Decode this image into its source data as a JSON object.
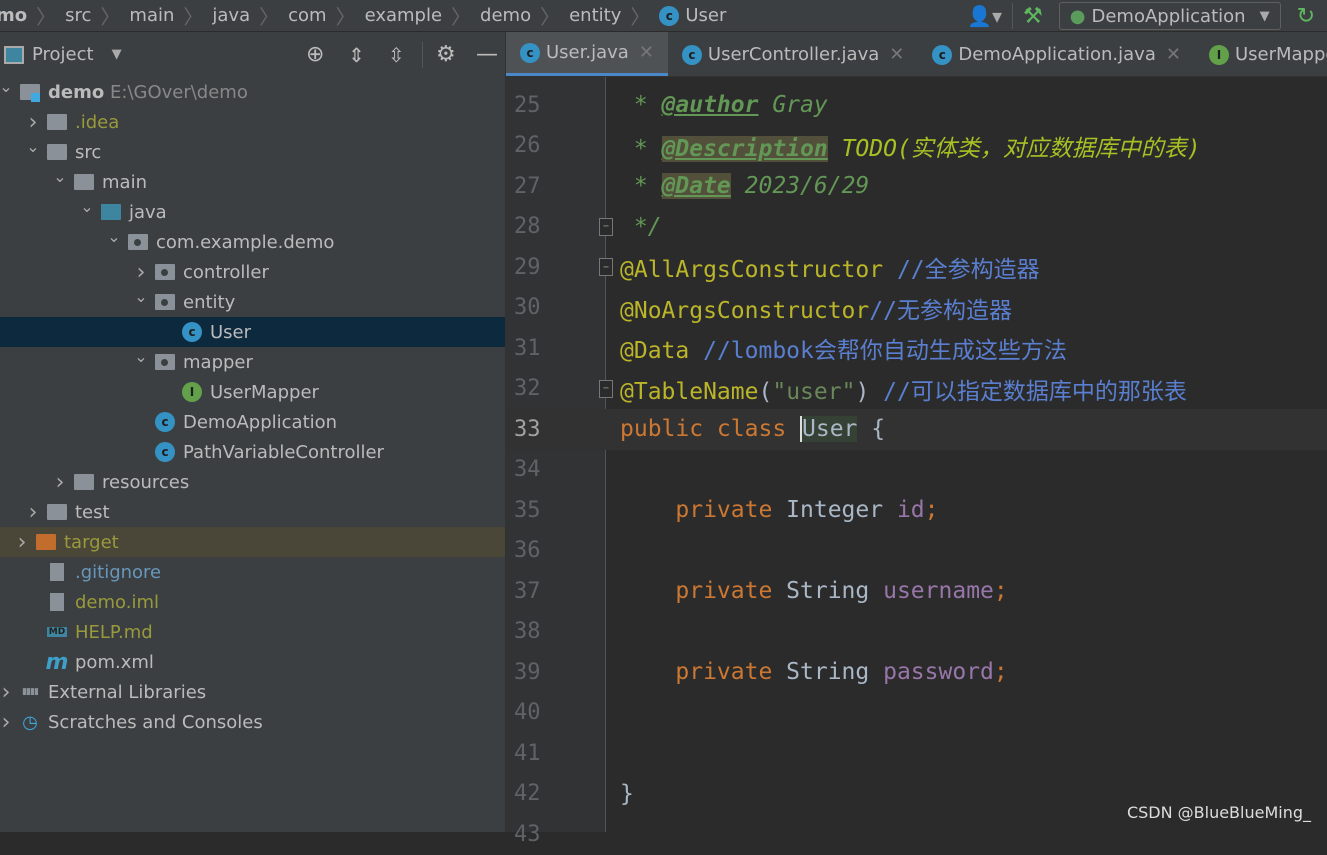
{
  "breadcrumb": [
    "mo",
    "src",
    "main",
    "java",
    "com",
    "example",
    "demo",
    "entity",
    "User"
  ],
  "toolbar": {
    "run_config": "DemoApplication",
    "icons": [
      "user-icon",
      "hammer-icon",
      "rerun-icon"
    ]
  },
  "project_panel": {
    "title": "Project"
  },
  "tree": [
    {
      "depth": 0,
      "label": "demo",
      "sub": "E:\\GOver\\demo",
      "arrow": "v",
      "icon": "module",
      "bold": true
    },
    {
      "depth": 1,
      "label": ".idea",
      "arrow": ">",
      "icon": "folder",
      "color": "#999a3b"
    },
    {
      "depth": 1,
      "label": "src",
      "arrow": "v",
      "icon": "folder"
    },
    {
      "depth": 2,
      "label": "main",
      "arrow": "v",
      "icon": "folder"
    },
    {
      "depth": 3,
      "label": "java",
      "arrow": "v",
      "icon": "folder-blue"
    },
    {
      "depth": 4,
      "label": "com.example.demo",
      "arrow": "v",
      "icon": "package"
    },
    {
      "depth": 5,
      "label": "controller",
      "arrow": ">",
      "icon": "package"
    },
    {
      "depth": 5,
      "label": "entity",
      "arrow": "v",
      "icon": "package"
    },
    {
      "depth": 6,
      "label": "User",
      "arrow": "",
      "icon": "class",
      "selected": true
    },
    {
      "depth": 5,
      "label": "mapper",
      "arrow": "v",
      "icon": "package"
    },
    {
      "depth": 6,
      "label": "UserMapper",
      "arrow": "",
      "icon": "interface"
    },
    {
      "depth": 5,
      "label": "DemoApplication",
      "arrow": "",
      "icon": "spring-class"
    },
    {
      "depth": 5,
      "label": "PathVariableController",
      "arrow": "",
      "icon": "class"
    },
    {
      "depth": 2,
      "label": "resources",
      "arrow": ">",
      "icon": "folder"
    },
    {
      "depth": 1,
      "label": "test",
      "arrow": ">",
      "icon": "folder"
    },
    {
      "depth": 0.6,
      "label": "target",
      "arrow": ">",
      "icon": "folder-orange",
      "color": "#999a3b",
      "ignored": true
    },
    {
      "depth": 1,
      "label": ".gitignore",
      "arrow": "",
      "icon": "file",
      "color": "#6897bb"
    },
    {
      "depth": 1,
      "label": "demo.iml",
      "arrow": "",
      "icon": "file",
      "color": "#999a3b"
    },
    {
      "depth": 1,
      "label": "HELP.md",
      "arrow": "",
      "icon": "md",
      "color": "#999a3b"
    },
    {
      "depth": 1,
      "label": "pom.xml",
      "arrow": "",
      "icon": "maven"
    },
    {
      "depth": 0,
      "label": "External Libraries",
      "arrow": ">",
      "icon": "libs"
    },
    {
      "depth": 0,
      "label": "Scratches and Consoles",
      "arrow": ">",
      "icon": "scratch"
    }
  ],
  "tabs": [
    {
      "label": "User.java",
      "icon": "class",
      "active": true
    },
    {
      "label": "UserController.java",
      "icon": "class"
    },
    {
      "label": "DemoApplication.java",
      "icon": "spring-class"
    },
    {
      "label": "UserMapper.java",
      "icon": "interface"
    }
  ],
  "editor": {
    "current_line": 33,
    "lines": [
      {
        "n": 25,
        "tokens": [
          [
            " * ",
            "doc"
          ],
          [
            "@author",
            "tag"
          ],
          [
            " Gray",
            "doc"
          ]
        ]
      },
      {
        "n": 26,
        "tokens": [
          [
            " * ",
            "doc"
          ],
          [
            "@Description",
            "tag hl"
          ],
          [
            " TODO(实体类，对应数据库中的表)",
            "todo"
          ]
        ]
      },
      {
        "n": 27,
        "tokens": [
          [
            " * ",
            "doc"
          ],
          [
            "@Date",
            "tag hl"
          ],
          [
            " 2023/6/29",
            "doc"
          ]
        ]
      },
      {
        "n": 28,
        "fold": true,
        "tokens": [
          [
            " */",
            "doc"
          ]
        ]
      },
      {
        "n": 29,
        "fold": true,
        "tokens": [
          [
            "@AllArgsConstructor",
            "ann"
          ],
          [
            " //全参构造器",
            "cm"
          ]
        ]
      },
      {
        "n": 30,
        "tokens": [
          [
            "@NoArgsConstructor",
            "ann"
          ],
          [
            "//无参构造器",
            "cm"
          ]
        ]
      },
      {
        "n": 31,
        "tokens": [
          [
            "@Data",
            "ann"
          ],
          [
            " //lombok会帮你自动生成这些方法",
            "cm"
          ]
        ]
      },
      {
        "n": 32,
        "fold": true,
        "tokens": [
          [
            "@TableName",
            "ann"
          ],
          [
            "(",
            "id"
          ],
          [
            "\"user\"",
            "str"
          ],
          [
            ")",
            "id"
          ],
          [
            " //可以指定数据库中的那张表",
            "cm"
          ]
        ]
      },
      {
        "n": 33,
        "tokens": [
          [
            "public class ",
            "kw"
          ],
          [
            "User",
            "cls"
          ],
          [
            " {",
            "id"
          ]
        ]
      },
      {
        "n": 34,
        "tokens": []
      },
      {
        "n": 35,
        "tokens": [
          [
            "    private ",
            "kw"
          ],
          [
            "Integer ",
            "id"
          ],
          [
            "id",
            "fld"
          ],
          [
            ";",
            "kw"
          ]
        ]
      },
      {
        "n": 36,
        "tokens": []
      },
      {
        "n": 37,
        "tokens": [
          [
            "    private ",
            "kw"
          ],
          [
            "String ",
            "id"
          ],
          [
            "username",
            "fld"
          ],
          [
            ";",
            "kw"
          ]
        ]
      },
      {
        "n": 38,
        "tokens": []
      },
      {
        "n": 39,
        "tokens": [
          [
            "    private ",
            "kw"
          ],
          [
            "String ",
            "id"
          ],
          [
            "password",
            "fld"
          ],
          [
            ";",
            "kw"
          ]
        ]
      },
      {
        "n": 40,
        "tokens": []
      },
      {
        "n": 41,
        "tokens": []
      },
      {
        "n": 42,
        "tokens": [
          [
            "}",
            "id"
          ]
        ]
      },
      {
        "n": 43,
        "tokens": []
      }
    ]
  },
  "watermark": "CSDN @BlueBlueMing_"
}
